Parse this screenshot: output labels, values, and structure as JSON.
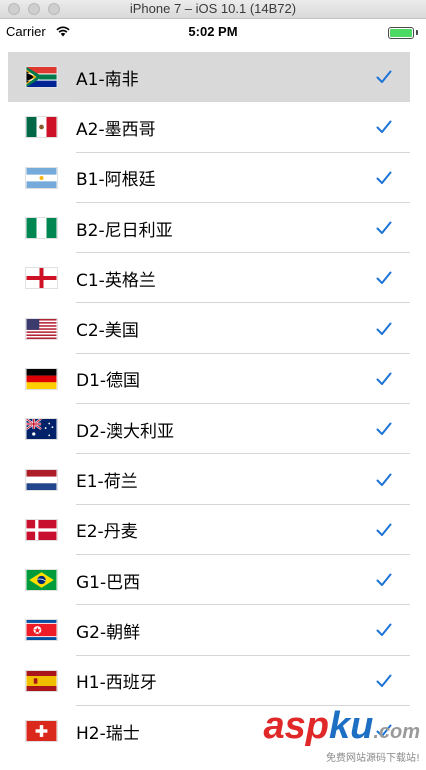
{
  "window": {
    "title": "iPhone 7 – iOS 10.1 (14B72)"
  },
  "status_bar": {
    "carrier": "Carrier",
    "time": "5:02 PM",
    "wifi_icon": "wifi-icon",
    "battery_icon": "battery-icon",
    "battery_level": 1.0
  },
  "colors": {
    "accent": "#1d73d6",
    "selected_row": "#d9d9d9",
    "battery_fill": "#4cd964"
  },
  "teams": [
    {
      "label": "A1-南非",
      "flag": "south-africa-flag-icon",
      "checked": true,
      "selected": true
    },
    {
      "label": "A2-墨西哥",
      "flag": "mexico-flag-icon",
      "checked": true
    },
    {
      "label": "B1-阿根廷",
      "flag": "argentina-flag-icon",
      "checked": true
    },
    {
      "label": "B2-尼日利亚",
      "flag": "nigeria-flag-icon",
      "checked": true
    },
    {
      "label": "C1-英格兰",
      "flag": "england-flag-icon",
      "checked": true
    },
    {
      "label": "C2-美国",
      "flag": "usa-flag-icon",
      "checked": true
    },
    {
      "label": "D1-德国",
      "flag": "germany-flag-icon",
      "checked": true
    },
    {
      "label": "D2-澳大利亚",
      "flag": "australia-flag-icon",
      "checked": true
    },
    {
      "label": "E1-荷兰",
      "flag": "netherlands-flag-icon",
      "checked": true
    },
    {
      "label": "E2-丹麦",
      "flag": "denmark-flag-icon",
      "checked": true
    },
    {
      "label": "G1-巴西",
      "flag": "brazil-flag-icon",
      "checked": true
    },
    {
      "label": "G2-朝鲜",
      "flag": "north-korea-flag-icon",
      "checked": true
    },
    {
      "label": "H1-西班牙",
      "flag": "spain-flag-icon",
      "checked": true
    },
    {
      "label": "H2-瑞士",
      "flag": "switzerland-flag-icon",
      "checked": true
    }
  ],
  "watermark": {
    "logo_a": "asp",
    "logo_b": "ku",
    "logo_c": ".com",
    "subtitle": "免费网站源码下载站!"
  }
}
